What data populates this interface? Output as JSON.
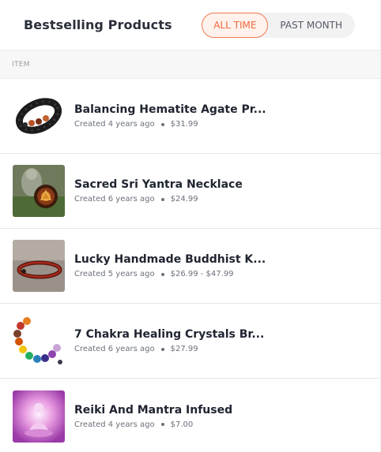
{
  "header": {
    "title": "Bestselling Products",
    "toggle": {
      "all_time": "ALL TIME",
      "past_month": "PAST MONTH",
      "selected": "ALL TIME"
    }
  },
  "table": {
    "column_header": "ITEM"
  },
  "products": [
    {
      "name": "Balancing Hematite Agate Pr...",
      "created": "Created 4 years ago",
      "price": "$31.99",
      "thumbnail": "black-bead-bracelet-image"
    },
    {
      "name": "Sacred Sri Yantra Necklace",
      "created": "Created 6 years ago",
      "price": "$24.99",
      "thumbnail": "yantra-necklace-image"
    },
    {
      "name": "Lucky Handmade Buddhist K...",
      "created": "Created 5 years ago",
      "price": "$26.99 - $47.99",
      "thumbnail": "red-string-bracelet-image"
    },
    {
      "name": "7 Chakra Healing Crystals Br...",
      "created": "Created 6 years ago",
      "price": "$27.99",
      "thumbnail": "chakra-bracelet-image"
    },
    {
      "name": "Reiki And Mantra Infused",
      "created": "Created 4 years ago",
      "price": "$7.00",
      "thumbnail": "reiki-figure-image"
    }
  ],
  "colors": {
    "accent": "#f06a3a",
    "accent_bg": "#fff1ec",
    "title_text": "#2b2f3a",
    "meta_text": "#6b707a"
  }
}
